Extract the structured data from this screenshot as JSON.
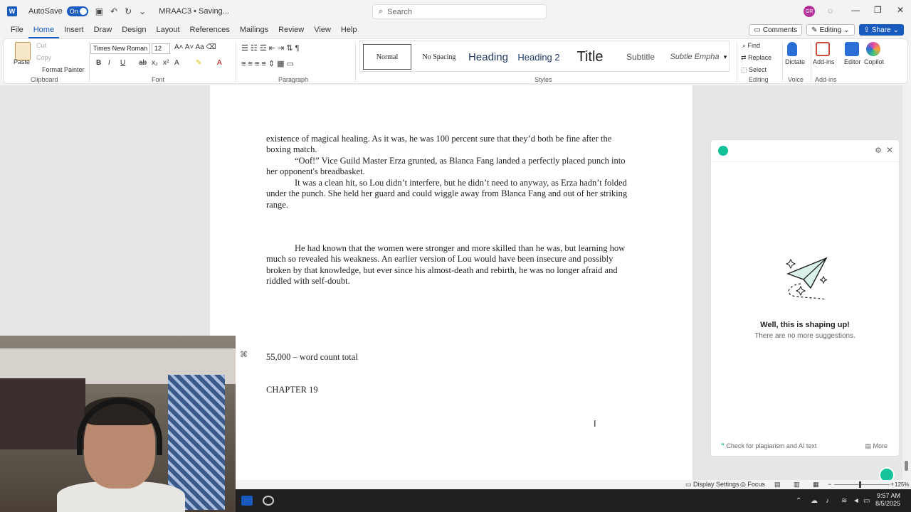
{
  "titlebar": {
    "autosave_label": "AutoSave",
    "autosave_state": "On",
    "doc_title": "MRAAC3 • Saving...",
    "search_placeholder": "Search",
    "avatar_initials": "GR"
  },
  "tabs": [
    "File",
    "Home",
    "Insert",
    "Draw",
    "Design",
    "Layout",
    "References",
    "Mailings",
    "Review",
    "View",
    "Help"
  ],
  "active_tab": "Home",
  "actions": {
    "comments": "Comments",
    "editing": "Editing",
    "share": "Share"
  },
  "ribbon": {
    "clipboard": {
      "paste": "Paste",
      "cut": "Cut",
      "copy": "Copy",
      "format_painter": "Format Painter",
      "label": "Clipboard"
    },
    "font": {
      "name": "Times New Roman",
      "size": "12",
      "label": "Font"
    },
    "paragraph_label": "Paragraph",
    "styles": {
      "items": [
        "Normal",
        "No Spacing",
        "Heading",
        "Heading 2",
        "Title",
        "Subtitle",
        "Subtle Empha"
      ],
      "label": "Styles"
    },
    "editing": {
      "find": "Find",
      "replace": "Replace",
      "select": "Select",
      "label": "Editing"
    },
    "voice": {
      "dictate": "Dictate",
      "label": "Voice"
    },
    "addins": {
      "addins": "Add-ins",
      "editor": "Editor",
      "copilot": "Copilot",
      "label": "Add-ins"
    }
  },
  "document": {
    "p1": "existence of magical healing. As it was, he was 100 percent sure that they’d both be fine after the boxing match.",
    "p2": "“Oof!” Vice Guild Master Erza grunted, as Blanca Fang landed a perfectly placed punch into her opponent's breadbasket.",
    "p3": "It was a clean hit, so Lou didn’t interfere, but he didn’t need to anyway, as Erza hadn’t folded under the punch. She held her guard and could wiggle away from Blanca Fang and out of her striking range.",
    "p4": "He had known that the women were stronger and more skilled than he was, but learning how much so revealed his weakness. An earlier version of Lou would have been insecure and possibly broken by that knowledge, but ever since his almost-death and rebirth, he was no longer afraid and riddled with self-doubt.",
    "word_count": "55,000 – word count total",
    "chapter": "CHAPTER 19"
  },
  "grammarly": {
    "title": "Well, this is shaping up!",
    "subtitle": "There are no more suggestions.",
    "footer": "Check for plagiarism and AI text",
    "more": "More"
  },
  "statusbar": {
    "display_settings": "Display Settings",
    "focus": "Focus",
    "zoom": "125%"
  },
  "taskbar": {
    "time": "9:57 AM",
    "date": "8/5/2025"
  }
}
